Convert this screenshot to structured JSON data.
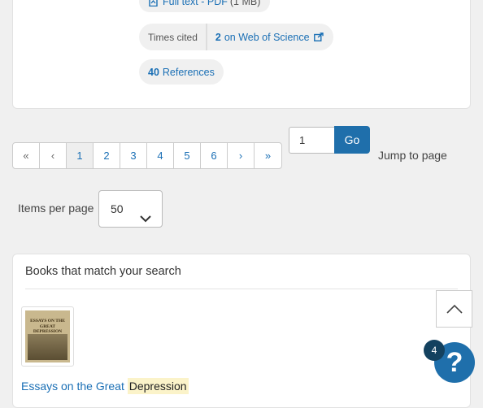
{
  "result": {
    "fulltext_label": "Full text - PDF",
    "fulltext_size": "(1 MB)",
    "times_cited_label": "Times cited",
    "times_cited_count": "2",
    "times_cited_source": "on Web of Science",
    "references_count": "40",
    "references_label": "References"
  },
  "pagination": {
    "first": "«",
    "prev": "‹",
    "pages": [
      "1",
      "2",
      "3",
      "4",
      "5",
      "6"
    ],
    "current": "1",
    "next": "›",
    "last": "»",
    "page_input_value": "1",
    "go_label": "Go",
    "jump_label": "Jump to page"
  },
  "items_per_page": {
    "label": "Items per page",
    "value": "50"
  },
  "books": {
    "heading": "Books that match your search",
    "first_title_prefix": "Essays on the Great",
    "first_title_highlight": "Depression",
    "cover_text": "ESSAYS ON THE GREAT DEPRESSION"
  },
  "widgets": {
    "help_badge_count": "4",
    "help_glyph": "?"
  },
  "colors": {
    "link": "#1a6fb5",
    "primary_button": "#1f6fab",
    "badge": "#13415f",
    "highlight": "#fbf3c9"
  }
}
